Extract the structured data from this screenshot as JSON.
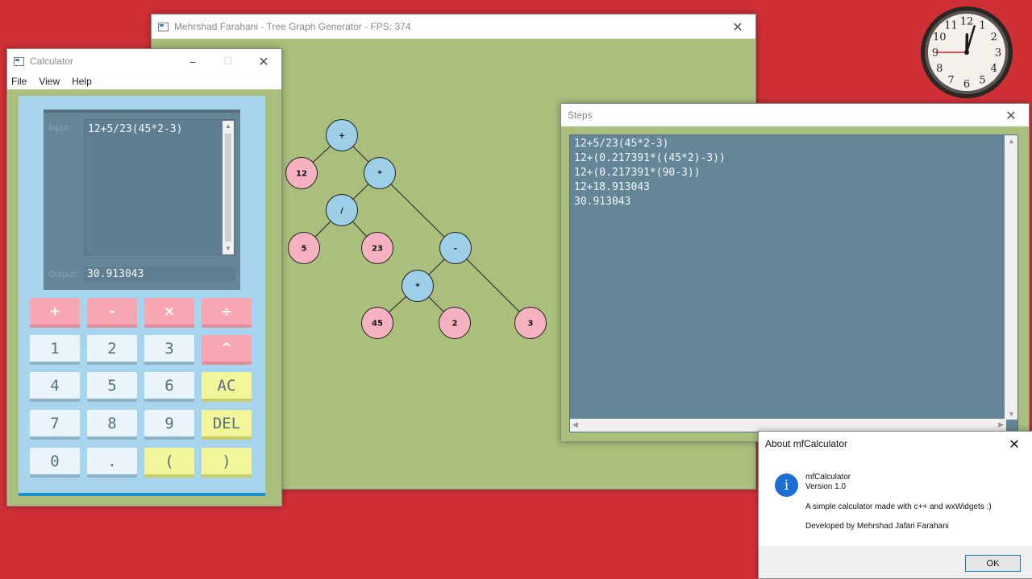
{
  "tree_window": {
    "title": "Mehrshad Farahani - Tree Graph Generator - FPS: 374",
    "close_icon": "close-icon",
    "nodes": [
      {
        "id": "n-plus",
        "label": "+",
        "color": "#9dcfe9"
      },
      {
        "id": "n-12",
        "label": "12",
        "color": "#f7b2c2"
      },
      {
        "id": "n-mul1",
        "label": "*",
        "color": "#9dcfe9"
      },
      {
        "id": "n-div",
        "label": "/",
        "color": "#9dcfe9"
      },
      {
        "id": "n-minus",
        "label": "-",
        "color": "#9dcfe9"
      },
      {
        "id": "n-5",
        "label": "5",
        "color": "#f7b2c2"
      },
      {
        "id": "n-23",
        "label": "23",
        "color": "#f7b2c2"
      },
      {
        "id": "n-mul2",
        "label": "*",
        "color": "#9dcfe9"
      },
      {
        "id": "n-3",
        "label": "3",
        "color": "#f7b2c2"
      },
      {
        "id": "n-45",
        "label": "45",
        "color": "#f7b2c2"
      },
      {
        "id": "n-2",
        "label": "2",
        "color": "#f7b2c2"
      }
    ],
    "edges": [
      [
        "n-plus",
        "n-12"
      ],
      [
        "n-plus",
        "n-mul1"
      ],
      [
        "n-mul1",
        "n-div"
      ],
      [
        "n-mul1",
        "n-minus"
      ],
      [
        "n-div",
        "n-5"
      ],
      [
        "n-div",
        "n-23"
      ],
      [
        "n-minus",
        "n-mul2"
      ],
      [
        "n-minus",
        "n-3"
      ],
      [
        "n-mul2",
        "n-45"
      ],
      [
        "n-mul2",
        "n-2"
      ]
    ]
  },
  "calculator": {
    "title": "Calculator",
    "menu": [
      "File",
      "View",
      "Help"
    ],
    "input_label": "Input:",
    "input_value": "12+5/23(45*2-3)",
    "output_label": "Output:",
    "output_value": "30.913043",
    "keys": [
      {
        "label": "+",
        "style": "pink",
        "name": "key-plus"
      },
      {
        "label": "-",
        "style": "pink",
        "name": "key-minus"
      },
      {
        "label": "×",
        "style": "pink",
        "name": "key-multiply"
      },
      {
        "label": "÷",
        "style": "pink",
        "name": "key-divide"
      },
      {
        "label": "1",
        "style": "light",
        "name": "key-1"
      },
      {
        "label": "2",
        "style": "light",
        "name": "key-2"
      },
      {
        "label": "3",
        "style": "light",
        "name": "key-3"
      },
      {
        "label": "^",
        "style": "pink",
        "name": "key-power"
      },
      {
        "label": "4",
        "style": "light",
        "name": "key-4"
      },
      {
        "label": "5",
        "style": "light",
        "name": "key-5"
      },
      {
        "label": "6",
        "style": "light",
        "name": "key-6"
      },
      {
        "label": "AC",
        "style": "yellow",
        "name": "key-ac"
      },
      {
        "label": "7",
        "style": "light",
        "name": "key-7"
      },
      {
        "label": "8",
        "style": "light",
        "name": "key-8"
      },
      {
        "label": "9",
        "style": "light",
        "name": "key-9"
      },
      {
        "label": "DEL",
        "style": "yellow",
        "name": "key-del"
      },
      {
        "label": "0",
        "style": "light",
        "name": "key-0"
      },
      {
        "label": ".",
        "style": "light",
        "name": "key-dot"
      },
      {
        "label": "(",
        "style": "yellow",
        "name": "key-open-paren"
      },
      {
        "label": ")",
        "style": "yellow",
        "name": "key-close-paren"
      }
    ]
  },
  "steps_window": {
    "title": "Steps",
    "lines": [
      "12+5/23(45*2-3)",
      "12+(0.217391*((45*2)-3))",
      "12+(0.217391*(90-3))",
      "12+18.913043",
      "30.913043"
    ]
  },
  "about_dialog": {
    "title": "About mfCalculator",
    "app_name": "mfCalculator",
    "version": "Version 1.0",
    "description": "A simple calculator made with c++ and wxWidgets :)",
    "developer": "Developed by Mehrshad Jafari Farahani",
    "ok_label": "OK",
    "icon": "info-icon"
  },
  "clock": {
    "numbers": [
      "12",
      "1",
      "2",
      "3",
      "4",
      "5",
      "6",
      "7",
      "8",
      "9",
      "10",
      "11"
    ],
    "time": {
      "hour": 12,
      "minute": 2,
      "second": 45
    }
  },
  "colors": {
    "desktop": "#cf3036",
    "canvas": "#a9bf7b",
    "operator_node": "#9dcfe9",
    "operand_node": "#f7b2c2"
  }
}
